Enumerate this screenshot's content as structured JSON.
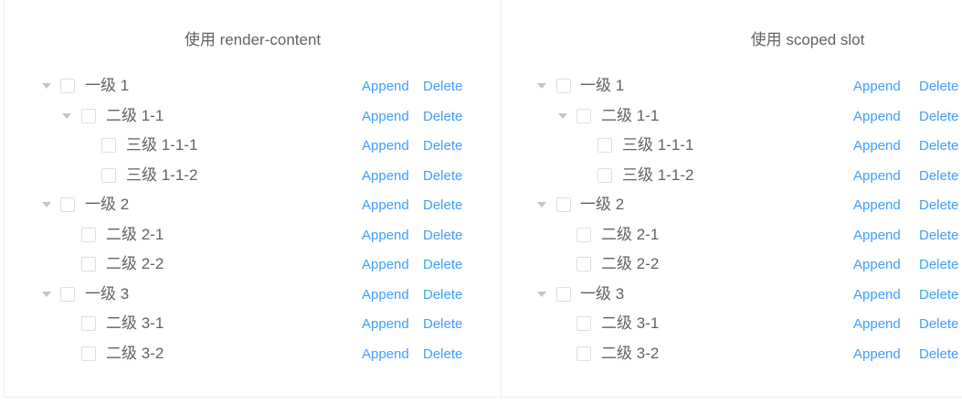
{
  "left_panel": {
    "title": "使用 render-content",
    "nodes": [
      {
        "label": "一级 1",
        "append": "Append",
        "delete": "Delete"
      },
      {
        "label": "二级 1-1",
        "append": "Append",
        "delete": "Delete"
      },
      {
        "label": "三级 1-1-1",
        "append": "Append",
        "delete": "Delete"
      },
      {
        "label": "三级 1-1-2",
        "append": "Append",
        "delete": "Delete"
      },
      {
        "label": "一级 2",
        "append": "Append",
        "delete": "Delete"
      },
      {
        "label": "二级 2-1",
        "append": "Append",
        "delete": "Delete"
      },
      {
        "label": "二级 2-2",
        "append": "Append",
        "delete": "Delete"
      },
      {
        "label": "一级 3",
        "append": "Append",
        "delete": "Delete"
      },
      {
        "label": "二级 3-1",
        "append": "Append",
        "delete": "Delete"
      },
      {
        "label": "二级 3-2",
        "append": "Append",
        "delete": "Delete"
      }
    ]
  },
  "right_panel": {
    "title": "使用 scoped slot",
    "nodes": [
      {
        "label": "一级 1",
        "append": "Append",
        "delete": "Delete"
      },
      {
        "label": "二级 1-1",
        "append": "Append",
        "delete": "Delete"
      },
      {
        "label": "三级 1-1-1",
        "append": "Append",
        "delete": "Delete"
      },
      {
        "label": "三级 1-1-2",
        "append": "Append",
        "delete": "Delete"
      },
      {
        "label": "一级 2",
        "append": "Append",
        "delete": "Delete"
      },
      {
        "label": "二级 2-1",
        "append": "Append",
        "delete": "Delete"
      },
      {
        "label": "二级 2-2",
        "append": "Append",
        "delete": "Delete"
      },
      {
        "label": "一级 3",
        "append": "Append",
        "delete": "Delete"
      },
      {
        "label": "二级 3-1",
        "append": "Append",
        "delete": "Delete"
      },
      {
        "label": "二级 3-2",
        "append": "Append",
        "delete": "Delete"
      }
    ]
  },
  "colors": {
    "link": "#409eff",
    "text": "#606266",
    "caret": "#c0c4cc",
    "border": "#dcdfe6"
  }
}
